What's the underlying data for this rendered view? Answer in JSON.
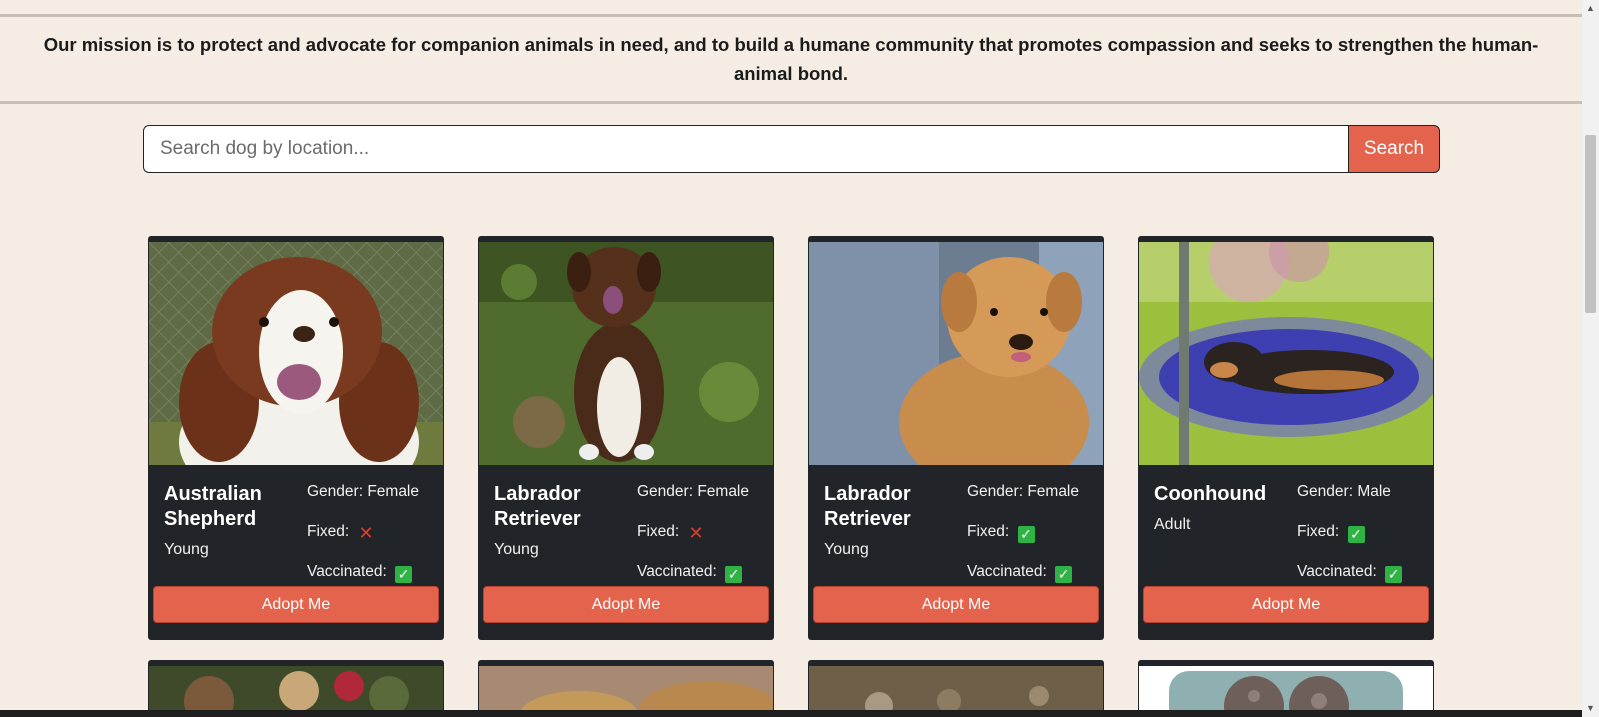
{
  "mission": {
    "text": "Our mission is to protect and advocate for companion animals in need, and to build a humane community that promotes compassion and seeks to strengthen the human-animal bond."
  },
  "search": {
    "placeholder": "Search dog by location...",
    "value": "",
    "button_label": "Search"
  },
  "labels": {
    "gender": "Gender: ",
    "fixed": "Fixed:",
    "vaccinated": "Vaccinated:",
    "adopt": "Adopt Me"
  },
  "dogs": [
    {
      "breed": "Australian Shepherd",
      "age": "Young",
      "gender": "Female",
      "fixed": false,
      "vaccinated": true
    },
    {
      "breed": "Labrador Retriever",
      "age": "Young",
      "gender": "Female",
      "fixed": false,
      "vaccinated": true
    },
    {
      "breed": "Labrador Retriever",
      "age": "Young",
      "gender": "Female",
      "fixed": true,
      "vaccinated": true
    },
    {
      "breed": "Coonhound",
      "age": "Adult",
      "gender": "Male",
      "fixed": true,
      "vaccinated": true
    }
  ],
  "colors": {
    "accent": "#e4634d",
    "card_bg": "#212529",
    "page_bg": "#f5ede4",
    "check_green": "#2fb344",
    "cross_red": "#e53b2c"
  },
  "icons": {
    "yes": "check-mark-icon",
    "no": "cross-mark-icon"
  }
}
